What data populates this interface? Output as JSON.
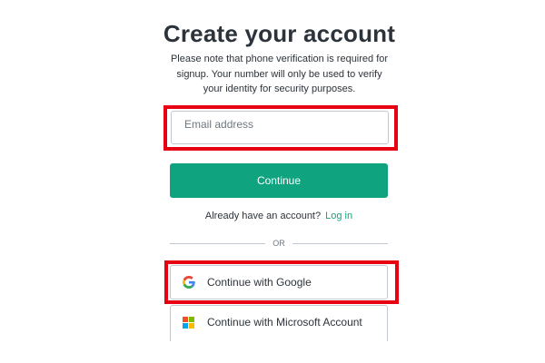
{
  "heading": {
    "title": "Create your account",
    "subtitle": "Please note that phone verification is required for signup. Your number will only be used to verify your identity for security purposes."
  },
  "email": {
    "placeholder": "Email address"
  },
  "continue_label": "Continue",
  "login_prompt": {
    "text": "Already have an account?",
    "link": "Log in"
  },
  "divider_text": "OR",
  "social": {
    "google_label": "Continue with Google",
    "microsoft_label": "Continue with Microsoft Account",
    "google_icon": "google-icon",
    "microsoft_icon": "microsoft-icon"
  },
  "colors": {
    "accent": "#10a37f",
    "highlight": "#e60012",
    "text": "#2d333a"
  }
}
